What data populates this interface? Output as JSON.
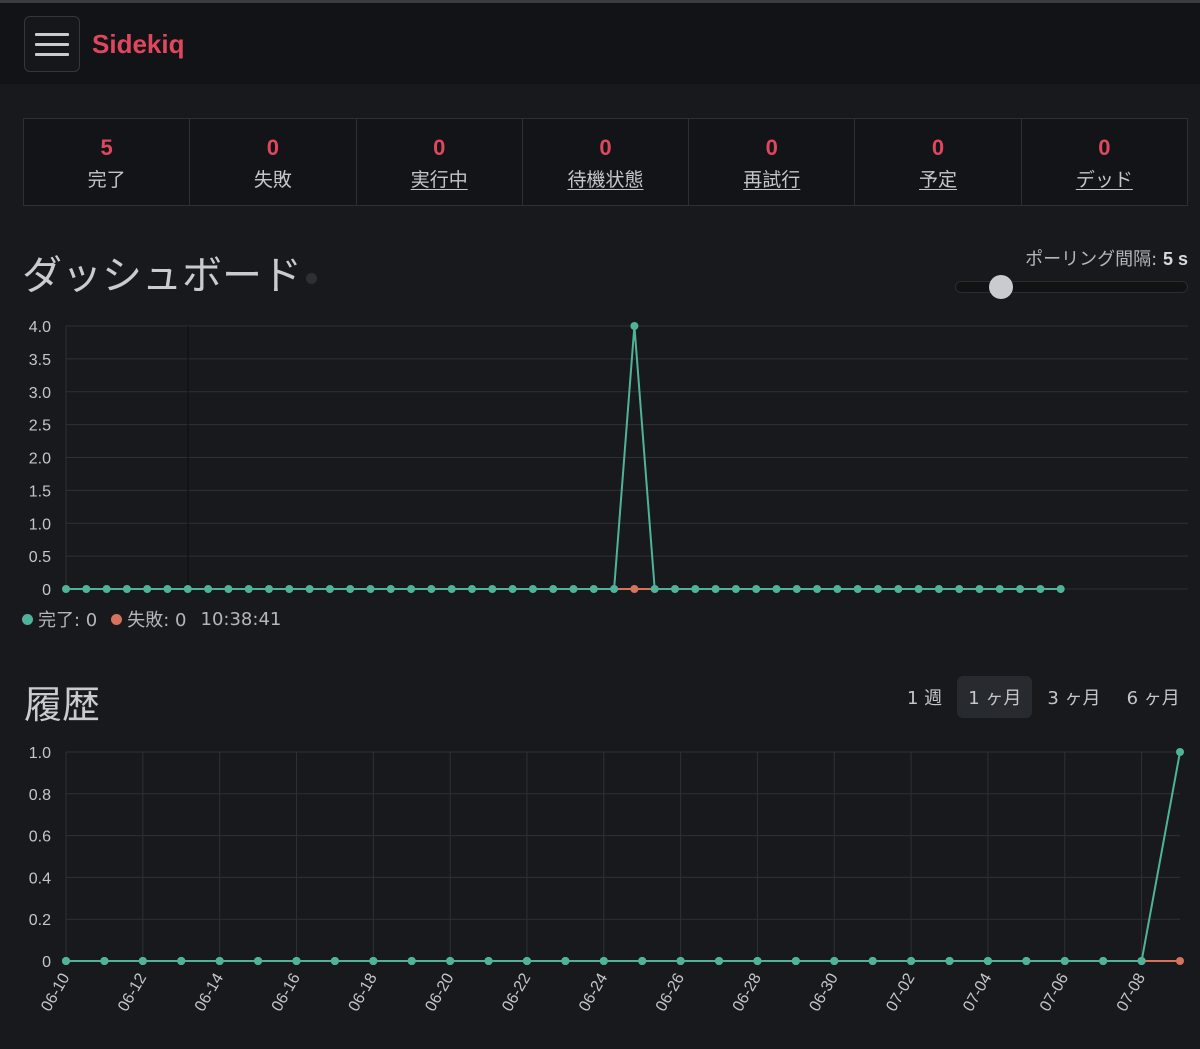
{
  "navbar": {
    "brand": "Sidekiq",
    "menu_icon": "hamburger-icon"
  },
  "stats": [
    {
      "value": "5",
      "label": "完了",
      "link": false
    },
    {
      "value": "0",
      "label": "失敗",
      "link": false
    },
    {
      "value": "0",
      "label": "実行中",
      "link": true
    },
    {
      "value": "0",
      "label": "待機状態",
      "link": true
    },
    {
      "value": "0",
      "label": "再試行",
      "link": true
    },
    {
      "value": "0",
      "label": "予定",
      "link": true
    },
    {
      "value": "0",
      "label": "デッド",
      "link": true
    }
  ],
  "dashboard": {
    "title": "ダッシュボード",
    "poll_label": "ポーリング間隔:",
    "poll_value": "5 s",
    "poll_interval_seconds": 5,
    "legend": {
      "processed_label": "完了: 0",
      "failed_label": "失敗: 0",
      "time": "10:38:41"
    }
  },
  "history": {
    "title": "履歴",
    "ranges": [
      {
        "label": "1 週",
        "active": false
      },
      {
        "label": "1 ヶ月",
        "active": true
      },
      {
        "label": "3 ヶ月",
        "active": false
      },
      {
        "label": "6 ヶ月",
        "active": false
      }
    ]
  },
  "colors": {
    "brand": "#e0475e",
    "processed": "#4fb39a",
    "failed": "#d5735d",
    "grid": "#2e3034"
  },
  "chart_data": [
    {
      "type": "line",
      "ylim": [
        0,
        4
      ],
      "yticks": [
        "4.0",
        "3.5",
        "3.0",
        "2.5",
        "2.0",
        "1.5",
        "1.0",
        "0.5",
        "0"
      ],
      "point_count": 50,
      "series": [
        {
          "name": "完了",
          "values": [
            0,
            0,
            0,
            0,
            0,
            0,
            0,
            0,
            0,
            0,
            0,
            0,
            0,
            0,
            0,
            0,
            0,
            0,
            0,
            0,
            0,
            0,
            0,
            0,
            0,
            0,
            0,
            0,
            4,
            0,
            0,
            0,
            0,
            0,
            0,
            0,
            0,
            0,
            0,
            0,
            0,
            0,
            0,
            0,
            0,
            0,
            0,
            0,
            0,
            0
          ]
        },
        {
          "name": "失敗",
          "values": [
            0,
            0,
            0,
            0,
            0,
            0,
            0,
            0,
            0,
            0,
            0,
            0,
            0,
            0,
            0,
            0,
            0,
            0,
            0,
            0,
            0,
            0,
            0,
            0,
            0,
            0,
            0,
            0,
            0,
            0,
            0,
            0,
            0,
            0,
            0,
            0,
            0,
            0,
            0,
            0,
            0,
            0,
            0,
            0,
            0,
            0,
            0,
            0,
            0,
            0
          ]
        }
      ]
    },
    {
      "type": "line",
      "ylim": [
        0,
        1
      ],
      "yticks": [
        "1.0",
        "0.8",
        "0.6",
        "0.4",
        "0.2",
        "0"
      ],
      "x": [
        "06-10",
        "06-11",
        "06-12",
        "06-13",
        "06-14",
        "06-15",
        "06-16",
        "06-17",
        "06-18",
        "06-19",
        "06-20",
        "06-21",
        "06-22",
        "06-23",
        "06-24",
        "06-25",
        "06-26",
        "06-27",
        "06-28",
        "06-29",
        "06-30",
        "07-01",
        "07-02",
        "07-03",
        "07-04",
        "07-05",
        "07-06",
        "07-07",
        "07-08",
        "07-09"
      ],
      "xticks": [
        "06-10",
        "06-12",
        "06-14",
        "06-16",
        "06-18",
        "06-20",
        "06-22",
        "06-24",
        "06-26",
        "06-28",
        "06-30",
        "07-02",
        "07-04",
        "07-06",
        "07-08"
      ],
      "series": [
        {
          "name": "完了",
          "values": [
            0,
            0,
            0,
            0,
            0,
            0,
            0,
            0,
            0,
            0,
            0,
            0,
            0,
            0,
            0,
            0,
            0,
            0,
            0,
            0,
            0,
            0,
            0,
            0,
            0,
            0,
            0,
            0,
            0,
            1
          ]
        },
        {
          "name": "失敗",
          "values": [
            0,
            0,
            0,
            0,
            0,
            0,
            0,
            0,
            0,
            0,
            0,
            0,
            0,
            0,
            0,
            0,
            0,
            0,
            0,
            0,
            0,
            0,
            0,
            0,
            0,
            0,
            0,
            0,
            0,
            0
          ]
        }
      ]
    }
  ]
}
